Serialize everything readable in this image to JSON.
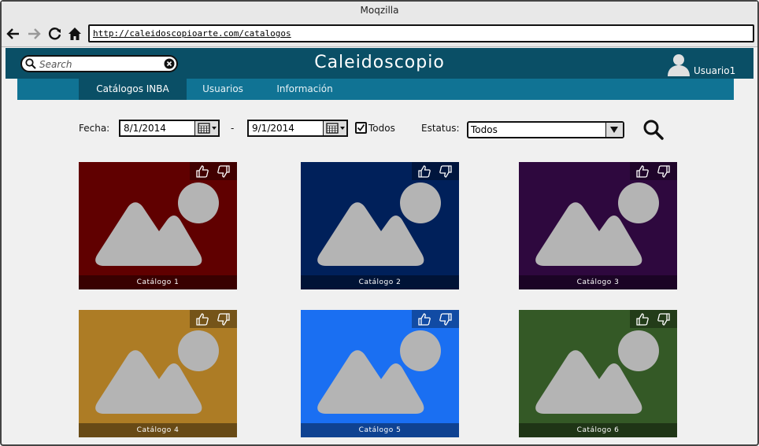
{
  "browser": {
    "title": "Moqzilla",
    "url": "http://caleidoscopioarte.com/catalogos",
    "nav_icons": [
      "back-arrow-icon",
      "forward-arrow-icon",
      "reload-icon",
      "home-icon"
    ]
  },
  "header": {
    "search_placeholder": "Search",
    "app_title": "Caleidoscopio",
    "user_name": "Usuario1",
    "bar_color": "#0a4f66"
  },
  "tabs": [
    {
      "label": "Catálogos INBA",
      "active": true
    },
    {
      "label": "Usuarios",
      "active": false
    },
    {
      "label": "Información",
      "active": false
    }
  ],
  "filters": {
    "date_label": "Fecha:",
    "date_from": "8/1/2014",
    "separator": "-",
    "date_to": "9/1/2014",
    "all_label": "Todos",
    "all_checked": true,
    "status_label": "Estatus:",
    "status_value": "Todos"
  },
  "catalogs": [
    {
      "label": "Catálogo 1",
      "color": "#600000"
    },
    {
      "label": "Catálogo 2",
      "color": "#00205a"
    },
    {
      "label": "Catálogo 3",
      "color": "#2e083e"
    },
    {
      "label": "Catálogo 4",
      "color": "#ad7c25"
    },
    {
      "label": "Catálogo 5",
      "color": "#1a6ff2"
    },
    {
      "label": "Catálogo 6",
      "color": "#345926"
    }
  ]
}
